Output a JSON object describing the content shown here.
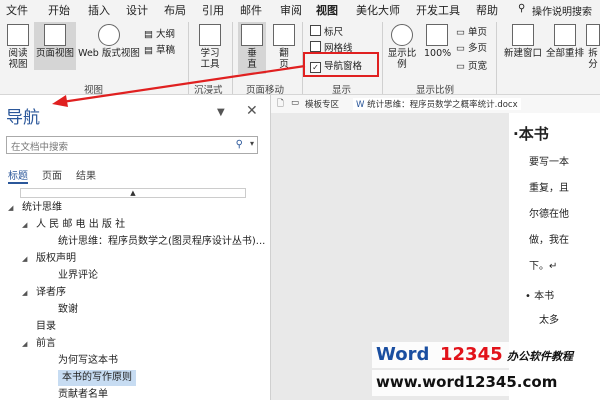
{
  "menubar": {
    "items": [
      "文件",
      "开始",
      "插入",
      "设计",
      "布局",
      "引用",
      "邮件",
      "审阅",
      "视图",
      "美化大师",
      "开发工具",
      "帮助"
    ],
    "active": "视图",
    "tell_me": "操作说明搜索"
  },
  "ribbon": {
    "read_mode": "阅读\n视图",
    "print_layout": "页面视图",
    "web_layout": "Web 版式视图",
    "outline": "大纲",
    "draft": "草稿",
    "group_view": "视图",
    "learning_tools": "学习\n工具",
    "group_immersive": "沉浸式",
    "vertical": "垂\n直",
    "side_to_side": "翻\n页",
    "group_page_movement": "页面移动",
    "ruler": "标尺",
    "gridlines": "网格线",
    "nav_pane": "导航窗格",
    "group_show": "显示",
    "zoom": "显示比例",
    "zoom_100": "100%",
    "one_page": "单页",
    "multi_page": "多页",
    "page_width": "页宽",
    "group_zoom": "显示比例",
    "new_window": "新建窗口",
    "arrange_all": "全部重排",
    "split": "拆分"
  },
  "nav": {
    "title": "导航",
    "search_placeholder": "在文档中搜索",
    "tabs": [
      "标题",
      "页面",
      "结果"
    ],
    "tree": [
      {
        "label": "统计思维",
        "level": 0,
        "toggle": "◢"
      },
      {
        "label": "人 民 邮 电 出 版 社",
        "level": 1,
        "toggle": "◢"
      },
      {
        "label": "统计思维：程序员数学之(图灵程序设计丛书)...",
        "level": 2,
        "toggle": ""
      },
      {
        "label": "版权声明",
        "level": 1,
        "toggle": "◢"
      },
      {
        "label": "业界评论",
        "level": 2,
        "toggle": ""
      },
      {
        "label": "译者序",
        "level": 1,
        "toggle": "◢"
      },
      {
        "label": "致谢",
        "level": 2,
        "toggle": ""
      },
      {
        "label": "目录",
        "level": 1,
        "toggle": ""
      },
      {
        "label": "前言",
        "level": 1,
        "toggle": "◢"
      },
      {
        "label": "为何写这本书",
        "level": 2,
        "toggle": ""
      },
      {
        "label": "本书的写作原则",
        "level": 2,
        "toggle": "",
        "selected": true
      },
      {
        "label": "贡献者名单",
        "level": 2,
        "toggle": ""
      }
    ]
  },
  "doctabs": {
    "t1": "模板专区",
    "t2": "统计思维：程序员数学之概率统计.docx"
  },
  "document": {
    "heading": "·本书",
    "lines": [
      "要写一本",
      "重复，且",
      "尔德在他",
      "做，我在",
      "下。↵"
    ],
    "bullet1": "本书",
    "bullet2": "太多"
  },
  "watermark": {
    "word": "Word",
    "num": "12345",
    "tag": "办公软件教程",
    "url": "www.word12345.com"
  },
  "colors": {
    "accent": "#2b579a",
    "highlight": "#e02020",
    "selection": "#c7dcf2"
  }
}
